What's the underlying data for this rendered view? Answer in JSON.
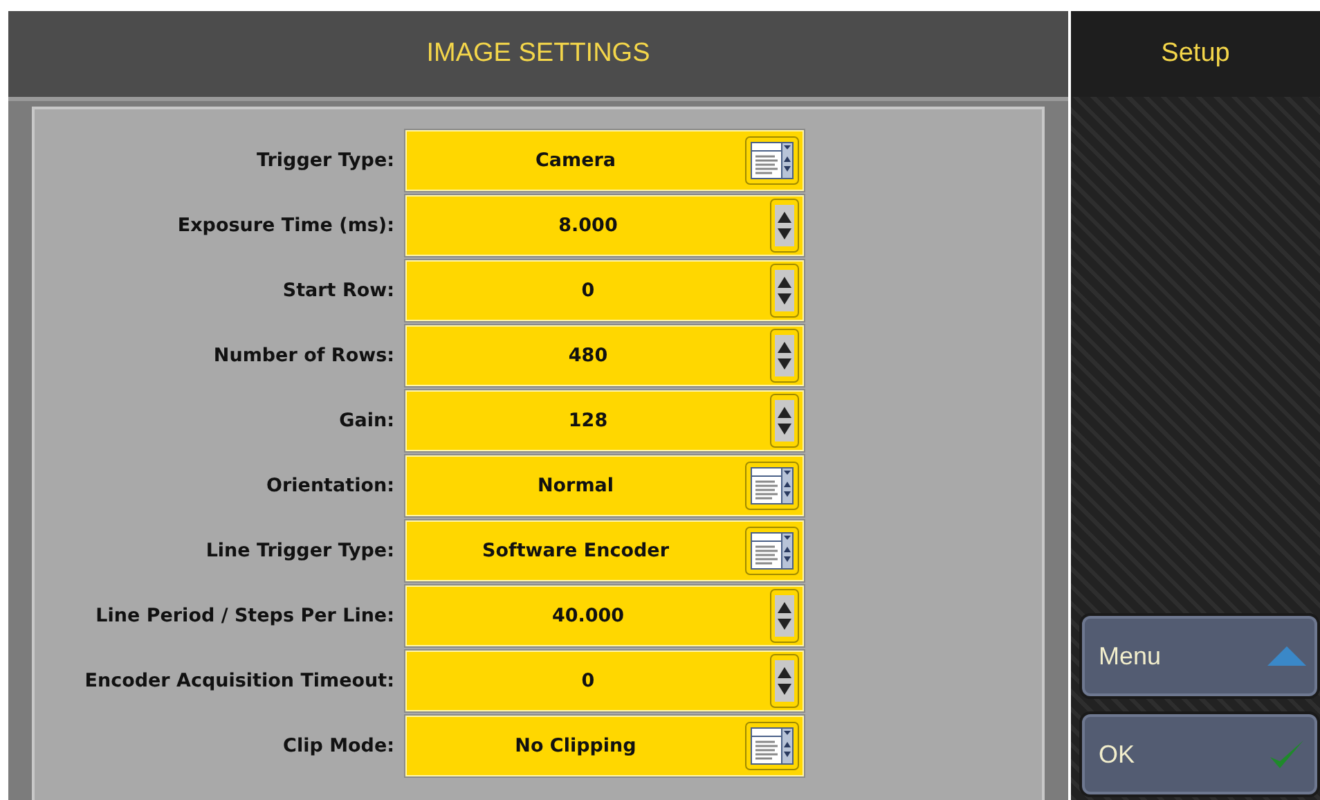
{
  "header": {
    "title": "IMAGE SETTINGS"
  },
  "side_panel": {
    "title": "Setup",
    "buttons": [
      {
        "label": "Menu",
        "kind": "menu"
      },
      {
        "label": "OK",
        "kind": "ok"
      }
    ]
  },
  "settings": [
    {
      "label": "Trigger Type:",
      "value": "Camera",
      "kind": "list"
    },
    {
      "label": "Exposure Time (ms):",
      "value": "8.000",
      "kind": "spin"
    },
    {
      "label": "Start Row:",
      "value": "0",
      "kind": "spin"
    },
    {
      "label": "Number of Rows:",
      "value": "480",
      "kind": "spin"
    },
    {
      "label": "Gain:",
      "value": "128",
      "kind": "spin"
    },
    {
      "label": "Orientation:",
      "value": "Normal",
      "kind": "list"
    },
    {
      "label": "Line Trigger Type:",
      "value": "Software Encoder",
      "kind": "list"
    },
    {
      "label": "Line Period / Steps Per Line:",
      "value": "40.000",
      "kind": "spin"
    },
    {
      "label": "Encoder Acquisition Timeout:",
      "value": "0",
      "kind": "spin"
    },
    {
      "label": "Clip Mode:",
      "value": "No Clipping",
      "kind": "list"
    }
  ]
}
